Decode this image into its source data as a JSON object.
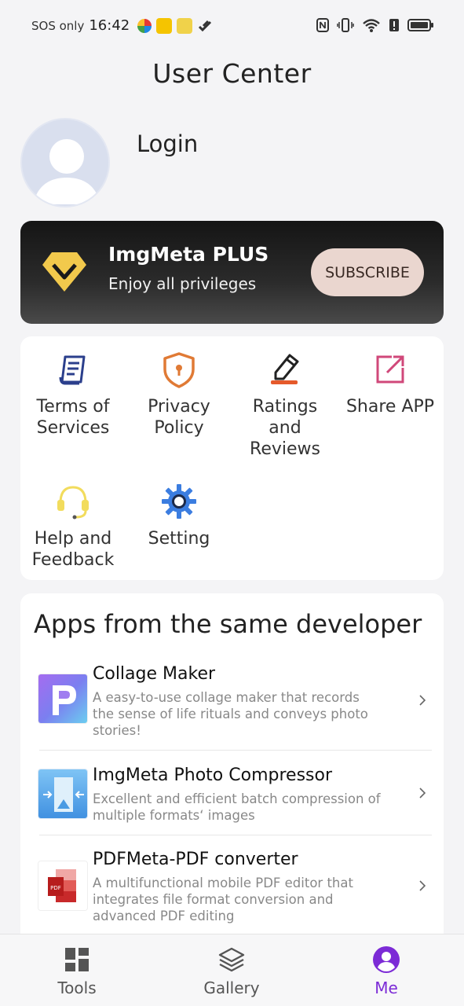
{
  "status_bar": {
    "sos": "SOS only",
    "time": "16:42"
  },
  "header": {
    "title": "User Center"
  },
  "profile": {
    "login_label": "Login"
  },
  "plus_banner": {
    "title": "ImgMeta PLUS",
    "subtitle": "Enjoy all privileges",
    "button_label": "SUBSCRIBE",
    "accent_color": "#f2c94c"
  },
  "menu": {
    "items": [
      {
        "label_lines": [
          "Terms of",
          "Services"
        ],
        "icon": "document-list-icon",
        "color": "#2b3f8c"
      },
      {
        "label_lines": [
          "Privacy",
          "Policy"
        ],
        "icon": "shield-lock-icon",
        "color": "#e07a35"
      },
      {
        "label_lines": [
          "Ratings",
          "and",
          "Reviews"
        ],
        "icon": "pencil-icon",
        "color": "#222222"
      },
      {
        "label_lines": [
          "Share APP"
        ],
        "icon": "share-external-icon",
        "color": "#d0487a"
      },
      {
        "label_lines": [
          "Help and",
          "Feedback"
        ],
        "icon": "headset-icon",
        "color": "#f2dc5d"
      },
      {
        "label_lines": [
          "Setting"
        ],
        "icon": "gear-icon",
        "color": "#3b7de0"
      }
    ]
  },
  "apps_section": {
    "title": "Apps from the same developer",
    "apps": [
      {
        "name": "Collage Maker",
        "desc_lines": [
          "A easy-to-use collage maker that records",
          "the sense of life rituals and conveys photo",
          "stories!"
        ],
        "icon": "collage-maker-app-icon"
      },
      {
        "name": "ImgMeta Photo Compressor",
        "desc_lines": [
          "Excellent and efficient batch compression of",
          "multiple formats‘ images"
        ],
        "icon": "photo-compressor-app-icon"
      },
      {
        "name": "PDFMeta-PDF converter",
        "desc_lines": [
          "A multifunctional mobile PDF editor that",
          "integrates file format conversion and",
          "advanced PDF editing"
        ],
        "icon": "pdf-converter-app-icon"
      }
    ]
  },
  "bottom_nav": {
    "tabs": [
      {
        "label": "Tools",
        "icon": "grid-icon",
        "active": false
      },
      {
        "label": "Gallery",
        "icon": "layers-icon",
        "active": false
      },
      {
        "label": "Me",
        "icon": "user-circle-icon",
        "active": true
      }
    ],
    "active_color": "#7c2bd6"
  }
}
